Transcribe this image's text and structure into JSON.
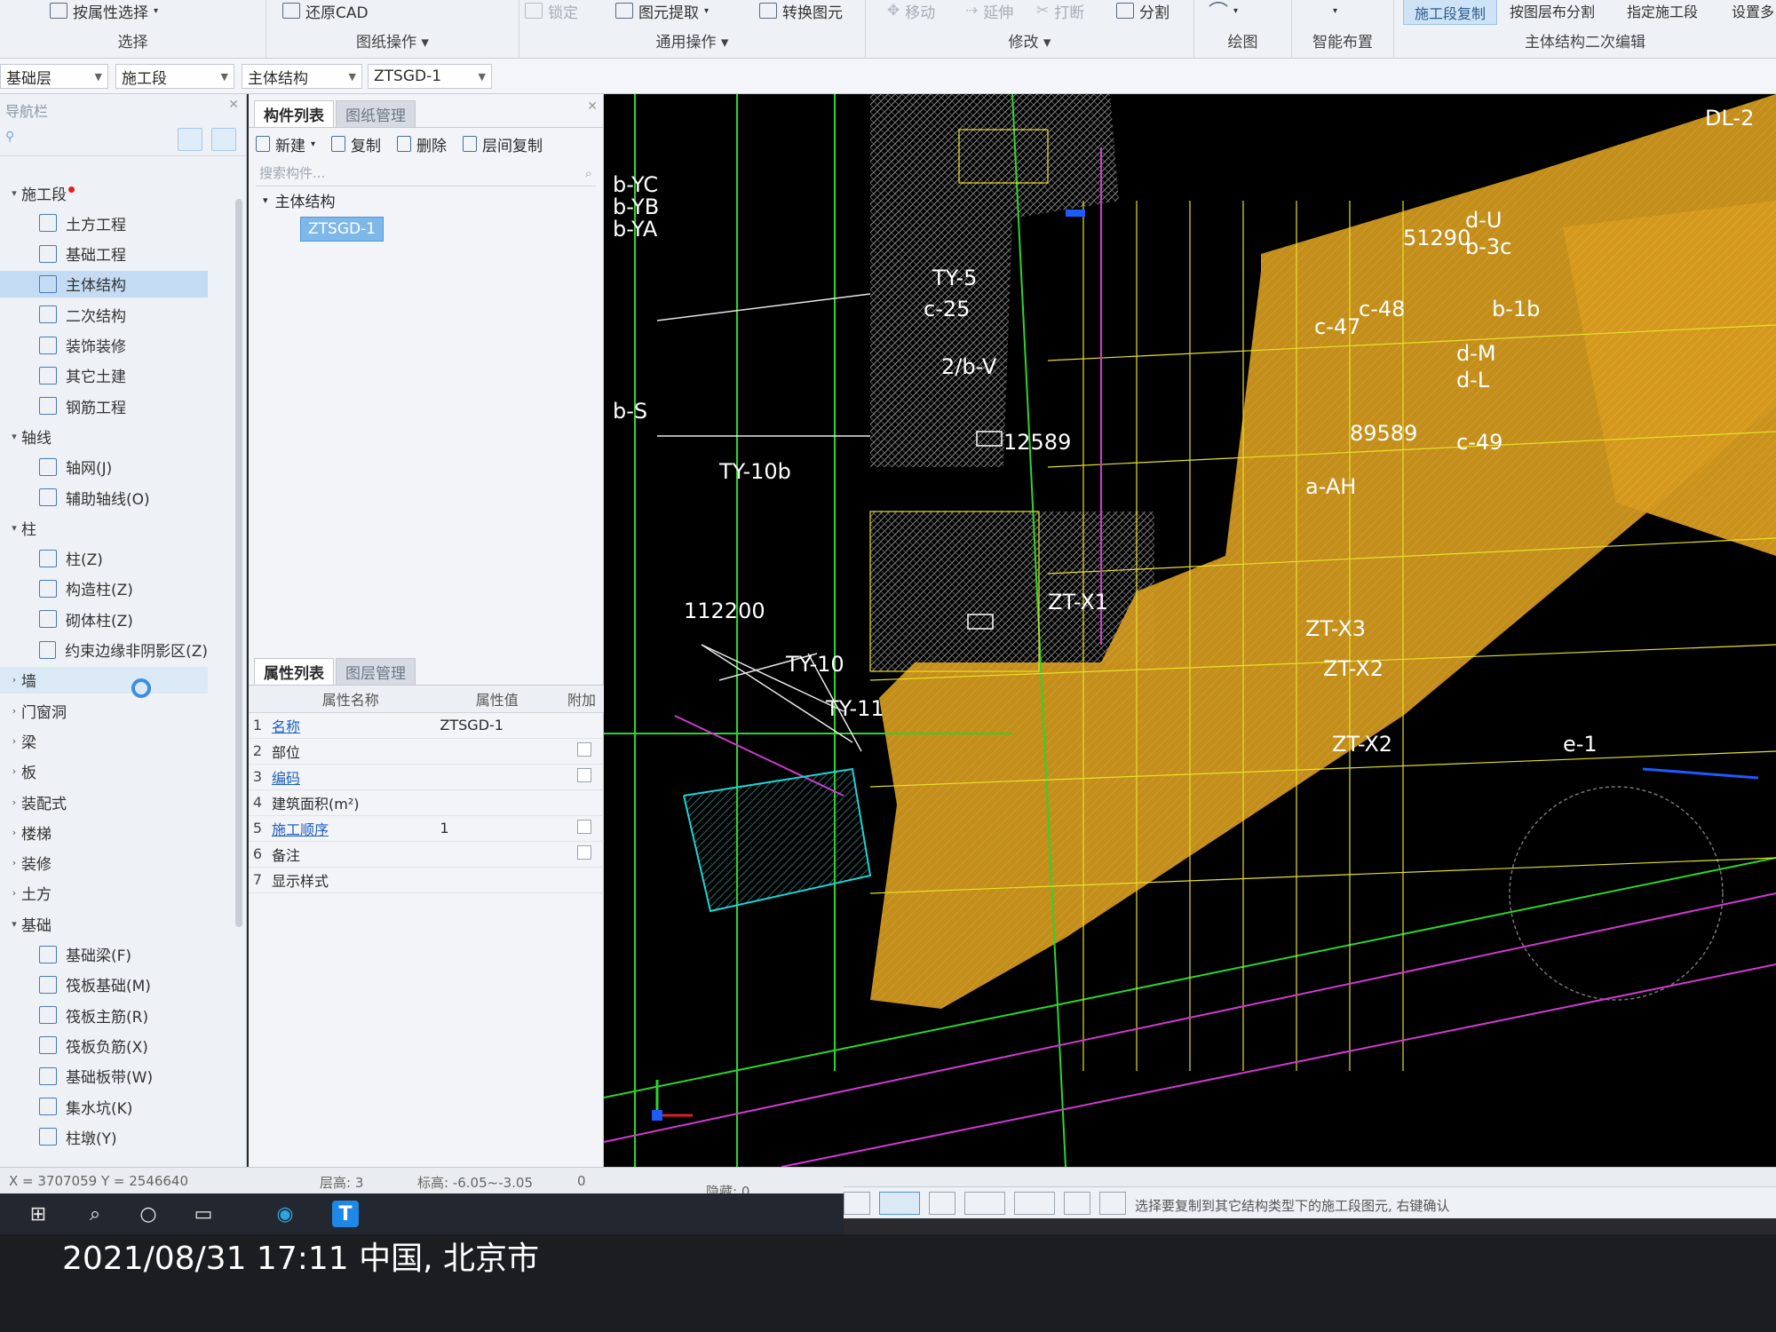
{
  "ribbon": {
    "top_buttons": [
      {
        "label": "按属性选择",
        "dim": false
      },
      {
        "label": "还原CAD",
        "dim": false
      },
      {
        "label": "锁定",
        "dim": true
      },
      {
        "label": "图元提取",
        "dim": false
      },
      {
        "label": "转换图元",
        "dim": false
      },
      {
        "label": "移动",
        "dim": true
      },
      {
        "label": "延伸",
        "dim": true
      },
      {
        "label": "打断",
        "dim": true
      },
      {
        "label": "分割",
        "dim": false
      }
    ],
    "groups": [
      "选择",
      "图纸操作",
      "通用操作",
      "修改",
      "绘图",
      "智能布置",
      "主体结构二次编辑"
    ],
    "right_tabs": [
      "施工段复制",
      "按图层布分割",
      "指定施工段",
      "设置多"
    ]
  },
  "selectors": {
    "floor": "基础层",
    "category": "施工段",
    "type": "主体结构",
    "item": "ZTSGD-1"
  },
  "nav": {
    "title": "导航栏",
    "items": [
      {
        "label": "施工段",
        "level": 0,
        "dot": true
      },
      {
        "label": "土方工程",
        "level": 1
      },
      {
        "label": "基础工程",
        "level": 1
      },
      {
        "label": "主体结构",
        "level": 1,
        "selected": true
      },
      {
        "label": "二次结构",
        "level": 1
      },
      {
        "label": "装饰装修",
        "level": 1
      },
      {
        "label": "其它土建",
        "level": 1
      },
      {
        "label": "钢筋工程",
        "level": 1
      },
      {
        "label": "轴线",
        "level": 0
      },
      {
        "label": "轴网(J)",
        "level": 1
      },
      {
        "label": "辅助轴线(O)",
        "level": 1
      },
      {
        "label": "柱",
        "level": 0
      },
      {
        "label": "柱(Z)",
        "level": 1
      },
      {
        "label": "构造柱(Z)",
        "level": 1
      },
      {
        "label": "砌体柱(Z)",
        "level": 1
      },
      {
        "label": "约束边缘非阴影区(Z)",
        "level": 1
      },
      {
        "label": "墙",
        "level": 0,
        "hover": true,
        "collapsed": true
      },
      {
        "label": "门窗洞",
        "level": 0,
        "collapsed": true
      },
      {
        "label": "梁",
        "level": 0,
        "collapsed": true
      },
      {
        "label": "板",
        "level": 0,
        "collapsed": true
      },
      {
        "label": "装配式",
        "level": 0,
        "collapsed": true
      },
      {
        "label": "楼梯",
        "level": 0,
        "collapsed": true
      },
      {
        "label": "装修",
        "level": 0,
        "collapsed": true
      },
      {
        "label": "土方",
        "level": 0,
        "collapsed": true
      },
      {
        "label": "基础",
        "level": 0
      },
      {
        "label": "基础梁(F)",
        "level": 1
      },
      {
        "label": "筏板基础(M)",
        "level": 1
      },
      {
        "label": "筏板主筋(R)",
        "level": 1
      },
      {
        "label": "筏板负筋(X)",
        "level": 1
      },
      {
        "label": "基础板带(W)",
        "level": 1
      },
      {
        "label": "集水坑(K)",
        "level": 1
      },
      {
        "label": "柱墩(Y)",
        "level": 1
      }
    ]
  },
  "component_panel": {
    "tabs": [
      "构件列表",
      "图纸管理"
    ],
    "toolbar": [
      "新建",
      "复制",
      "删除",
      "层间复制"
    ],
    "search_placeholder": "搜索构件...",
    "group": "主体结构",
    "component": "ZTSGD-1"
  },
  "property_panel": {
    "tabs": [
      "属性列表",
      "图层管理"
    ],
    "headers": [
      "属性名称",
      "属性值",
      "附加"
    ],
    "rows": [
      {
        "num": "1",
        "name": "名称",
        "value": "ZTSGD-1",
        "link": true,
        "check": false
      },
      {
        "num": "2",
        "name": "部位",
        "value": "",
        "link": false,
        "check": true
      },
      {
        "num": "3",
        "name": "编码",
        "value": "",
        "link": true,
        "check": true
      },
      {
        "num": "4",
        "name": "建筑面积(m²)",
        "value": "",
        "link": false,
        "check": false
      },
      {
        "num": "5",
        "name": "施工顺序",
        "value": "1",
        "link": true,
        "check": true
      },
      {
        "num": "6",
        "name": "备注",
        "value": "",
        "link": false,
        "check": true
      },
      {
        "num": "7",
        "name": "显示样式",
        "value": "",
        "link": false,
        "check": false
      }
    ]
  },
  "canvas_labels": [
    "TY-5",
    "c-25",
    "2/b-V",
    "TY-10b",
    "ZT-X1",
    "ZT-X3",
    "ZT-X2",
    "TY-10",
    "TY-11",
    "b-YC",
    "b-YB",
    "b-YA",
    "b-S",
    "a-AH",
    "d-M",
    "d-L",
    "c-49",
    "c-47",
    "c-48",
    "b-1b",
    "b-3c",
    "d-U",
    "ZT-X2",
    "e-1",
    "DL-2",
    "112200",
    "12589",
    "51290",
    "89589"
  ],
  "status": {
    "coords": "X = 3707059 Y = 2546640",
    "floor_height": "层高: 3",
    "elevation": "标高: -6.05~-3.05",
    "zero": "0",
    "hidden": "隐藏: 0",
    "hint": "选择要复制到其它结构类型下的施工段图元, 右键确认"
  },
  "timestamp": "2021/08/31 17:11  中国, 北京市",
  "colors": {
    "orange_fill": "#d59a1c",
    "cad_bg": "#000000",
    "selected_row": "#c3dcf3",
    "accent_blue": "#4f95d3"
  }
}
